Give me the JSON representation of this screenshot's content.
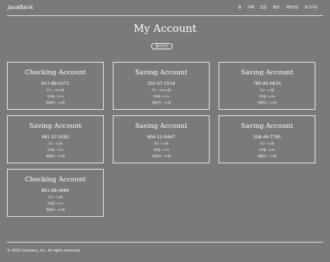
{
  "nav": {
    "brand": "JavaBank",
    "links": [
      "홈",
      "이체",
      "입금",
      "출금",
      "계좌생성",
      "로그아웃"
    ]
  },
  "page": {
    "title": "My Account",
    "back_label": "돌아가기"
  },
  "accounts": [
    {
      "type": "Checking Account",
      "number": "617-89-0271",
      "balance": "잔고 : 100.0원",
      "rate": "이자율 : 0.0%",
      "limit": "대출한도 : 0.0원"
    },
    {
      "type": "Saving Account",
      "number": "332-57-1516",
      "balance": "잔고 : 1000.0원",
      "rate": "이자율 : 0.0%",
      "limit": "대출한도 : 0.0원"
    },
    {
      "type": "Saving Account",
      "number": "785-85-0834",
      "balance": "잔고 : 0.0원",
      "rate": "이자율 : 0.0%",
      "limit": "대출한도 : 0.0원"
    },
    {
      "type": "Saving Account",
      "number": "481-37-3291",
      "balance": "잔고 : 0.0원",
      "rate": "이자율 : 0.0%",
      "limit": "대출한도 : 0.0원"
    },
    {
      "type": "Saving Account",
      "number": "804-12-9447",
      "balance": "잔고 : 0.0원",
      "rate": "이자율 : 0.0%",
      "limit": "대출한도 : 0.0원"
    },
    {
      "type": "Saving Account",
      "number": "358-49-7795",
      "balance": "잔고 : 0.0원",
      "rate": "이자율 : 0.0%",
      "limit": "대출한도 : 0.0원"
    },
    {
      "type": "Checking Account",
      "number": "861-68-4984",
      "balance": "잔고 : 0.0원",
      "rate": "이자율 : 0.0%",
      "limit": "대출한도 : 0.0원"
    }
  ],
  "footer": {
    "text": "© 2021 Company, Inc. All rights reserved."
  },
  "colors": {
    "background": "#7a7a7a",
    "text": "#ffffff"
  }
}
